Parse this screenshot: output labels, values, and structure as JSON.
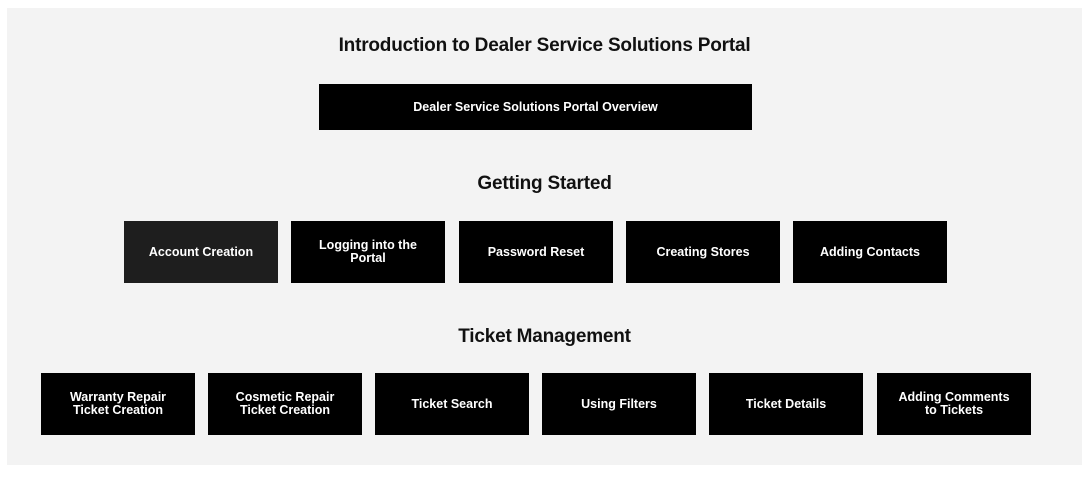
{
  "sections": {
    "intro": {
      "title": "Introduction to Dealer Service Solutions Portal",
      "buttons": [
        {
          "label": "Dealer Service Solutions Portal Overview"
        }
      ]
    },
    "getting_started": {
      "title": "Getting Started",
      "buttons": [
        {
          "label": "Account Creation"
        },
        {
          "label": "Logging into the Portal"
        },
        {
          "label": "Password Reset"
        },
        {
          "label": "Creating Stores"
        },
        {
          "label": "Adding Contacts"
        }
      ]
    },
    "ticket_management": {
      "title": "Ticket Management",
      "buttons": [
        {
          "label": "Warranty Repair Ticket Creation"
        },
        {
          "label": "Cosmetic Repair Ticket Creation"
        },
        {
          "label": "Ticket Search"
        },
        {
          "label": "Using Filters"
        },
        {
          "label": "Ticket Details"
        },
        {
          "label": "Adding Comments to Tickets"
        }
      ]
    }
  },
  "colors": {
    "panel_background": "#f3f3f3",
    "button_background": "#000000",
    "button_selected_background": "#1e1e1e",
    "button_text": "#ffffff",
    "heading_text": "#111111"
  }
}
